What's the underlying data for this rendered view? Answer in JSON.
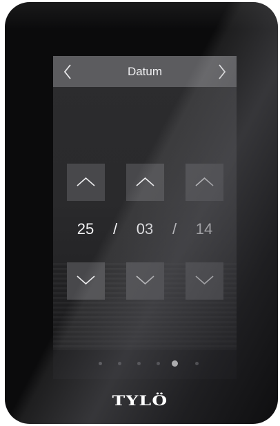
{
  "screen": {
    "title": "Datum",
    "prev_icon": "chevron-left-icon",
    "next_icon": "chevron-right-icon"
  },
  "date": {
    "day": "25",
    "month": "03",
    "year": "14",
    "separator": "/"
  },
  "steppers": {
    "up_icon": "chevron-up-icon",
    "down_icon": "chevron-down-icon"
  },
  "pagination": {
    "total": 6,
    "active_index": 4
  },
  "brand": {
    "logo_text": "TYLÖ"
  },
  "colors": {
    "device_body": "#0b0b0c",
    "header_bar": "#5c5c5f",
    "button_bg": "#48484b",
    "text": "#f4f4f6",
    "active_dot": "#ffffff",
    "inactive_dot": "#5a5a5e"
  }
}
